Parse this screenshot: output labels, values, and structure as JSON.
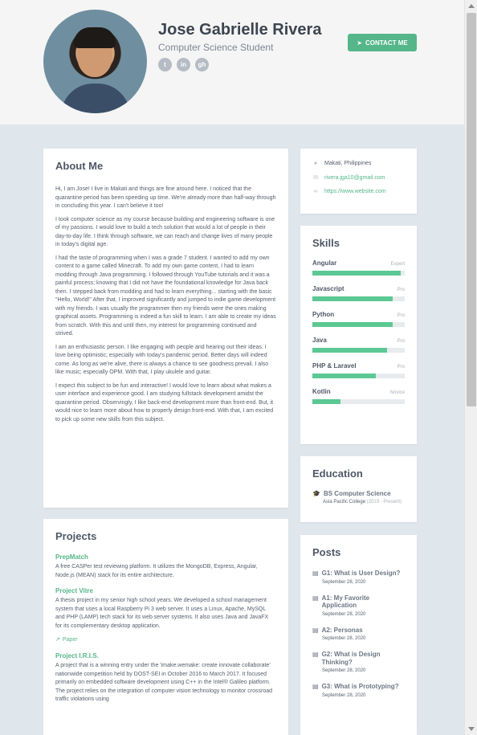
{
  "header": {
    "name": "Jose Gabrielle Rivera",
    "tagline": "Computer Science Student",
    "socials": [
      {
        "icon": "twitter-icon",
        "glyph": "t"
      },
      {
        "icon": "linkedin-icon",
        "glyph": "in"
      },
      {
        "icon": "github-icon",
        "glyph": "gh"
      }
    ],
    "contact_label": "CONTACT ME"
  },
  "about": {
    "title": "About Me",
    "paragraphs": [
      "Hi, I am Jose! I live in Makati and things are fine around here. I noticed that the quarantine period has been speeding up time. We're already more than half-way through in concluding this year. I can't believe it too!",
      "I took computer science as my course because building and engineering software is one of my passions. I would love to build a tech solution that would a lot of people in their day-to-day life. I think through software, we can reach and change lives of many people in today's digital age.",
      "I had the taste of programming when I was a grade 7 student. I wanted to add my own content to a game called Minecraft. To add my own game content, I had to learn modding through Java programming. I followed through YouTube tutorials and it was a painful process; knowing that I did not have the foundational knowledge for Java back then. I stepped back from modding and had to learn everything... starting with the basic \"Hello, World!\" After that, I improved significantly and jumped to indie game development with my friends. I was usually the programmer then my friends were the ones making graphical assets. Programming is indeed a fun skill to learn. I am able to create my ideas from scratch. With this and until then, my interest for programming continued and strived.",
      "I am an enthusiastic person. I like engaging with people and hearing out their ideas. I love being optimistic; especially with today's pandemic period. Better days will indeed come. As long as we're alive, there is always a chance to see goodness prevail. I also like music; especially OPM. With that, I play ukulele and guitar.",
      "I expect this subject to be fun and interactive! I would love to learn about what makes a user interface and experience good. I am studying fullstack development amidst the quarantine period. Observingly, I like back-end development more than front-end. But, it would nice to learn more about how to properly design front-end. With that, I am excited to pick up some new skills from this subject."
    ]
  },
  "projects": {
    "title": "Projects",
    "items": [
      {
        "name": "PrepMatch",
        "desc": "A free CASPer test reviewing platform. It utilizes the MongoDB, Express, Angular, Node.js (MEAN) stack for its entire architecture.",
        "link": ""
      },
      {
        "name": "Project Vitre",
        "desc": "A thesis project in my senior high school years. We developed a school management system that uses a local Raspberry Pi 3 web server. It uses a Linux, Apache, MySQL and PHP (LAMP) tech stack for its web server systems. It also uses Java and JavaFX for its complementary desktop application.",
        "link": "Paper"
      },
      {
        "name": "Project I.R.I.S.",
        "desc": "A project that is a winning entry under the 'imake.wemake: create innovate collaborate' nationwide competition held by DOST-SEI in October 2016 to March 2017. It focused primarily on embedded software development using C++ in the Intel® Galileo platform. The project relies on the integration of computer vision technology to monitor crossroad traffic violations using",
        "link": ""
      }
    ]
  },
  "contact": {
    "location": "Makati, Philippines",
    "email": "rivera.jga10@gmail.com",
    "website": "https://www.website.com"
  },
  "skills": {
    "title": "Skills",
    "items": [
      {
        "name": "Angular",
        "level": "Expert",
        "fill": 0.96
      },
      {
        "name": "Javascript",
        "level": "Pro",
        "fill": 0.87
      },
      {
        "name": "Python",
        "level": "Pro",
        "fill": 0.87
      },
      {
        "name": "Java",
        "level": "Pro",
        "fill": 0.81
      },
      {
        "name": "PHP & Laravel",
        "level": "Pro",
        "fill": 0.69
      },
      {
        "name": "Kotlin",
        "level": "Novice",
        "fill": 0.3
      }
    ]
  },
  "education": {
    "title": "Education",
    "degree": "BS Computer Science",
    "school": "Asia Pacific College",
    "years": "(2019 - Present)"
  },
  "posts": {
    "title": "Posts",
    "items": [
      {
        "title": "G1: What is User Design?",
        "date": "September 28, 2020"
      },
      {
        "title": "A1: My Favorite Application",
        "date": "September 28, 2020"
      },
      {
        "title": "A2: Personas",
        "date": "September 28, 2020"
      },
      {
        "title": "G2: What is Design Thinking?",
        "date": "September 28, 2020"
      },
      {
        "title": "G3: What is Prototyping?",
        "date": "September 28, 2020"
      }
    ]
  },
  "colors": {
    "accent": "#54b689",
    "skill_bar": "#5cc893",
    "background": "#dfe6ec",
    "header": "#f5f5f5"
  }
}
